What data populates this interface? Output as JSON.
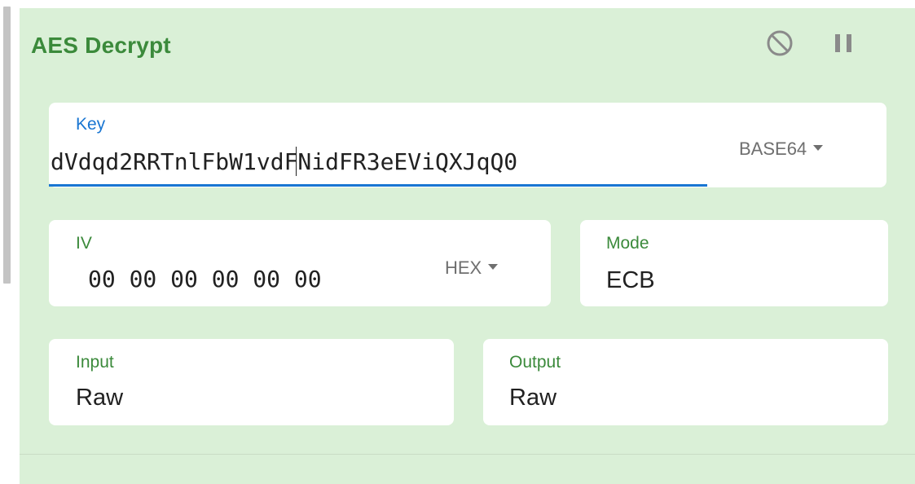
{
  "operation": {
    "title": "AES Decrypt",
    "disable_icon": "disable-icon",
    "pause_icon": "pause-icon",
    "accent_color": "#3b8a3b",
    "background_color": "#daf0d7"
  },
  "key": {
    "label": "Key",
    "value": "dVdqd2RRTnlFbW1vdFNidFR3eEViQXJqQ0",
    "format": "BASE64"
  },
  "iv": {
    "label": "IV",
    "value": "00 00 00 00 00 00",
    "format": "HEX"
  },
  "mode": {
    "label": "Mode",
    "value": "ECB"
  },
  "input": {
    "label": "Input",
    "value": "Raw"
  },
  "output": {
    "label": "Output",
    "value": "Raw"
  }
}
